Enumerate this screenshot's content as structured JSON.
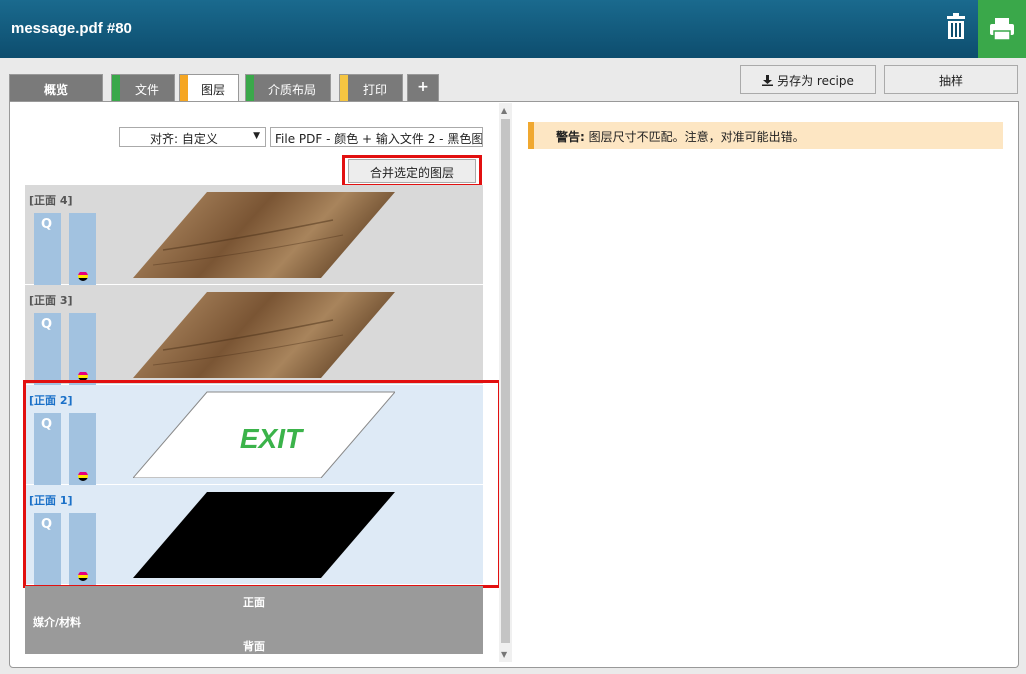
{
  "header": {
    "title": "message.pdf #80"
  },
  "tabs": [
    {
      "label": "概览",
      "active": false,
      "stripe": null
    },
    {
      "label": "文件",
      "active": false,
      "stripe": "#3aa84a"
    },
    {
      "label": "图层",
      "active": true,
      "stripe": "#f5a623"
    },
    {
      "label": "介质布局",
      "active": false,
      "stripe": "#3aa84a"
    },
    {
      "label": "打印",
      "active": false,
      "stripe": "#f5c542"
    },
    {
      "label": "+",
      "active": false,
      "stripe": null
    }
  ],
  "toolbar": {
    "save_recipe_label": "另存为 recipe",
    "sample_label": "抽样"
  },
  "layers_panel": {
    "align_select_value": "对齐: 自定义",
    "file_input_value": "File PDF - 颜色 + 输入文件 2 - 黑色图",
    "merge_button_label": "合并选定的图层",
    "layers": [
      {
        "title": "[正面 4]",
        "selected": false,
        "content": "wood"
      },
      {
        "title": "[正面 3]",
        "selected": false,
        "content": "wood"
      },
      {
        "title": "[正面 2]",
        "selected": true,
        "content": "exit",
        "content_text": "EXIT"
      },
      {
        "title": "[正面 1]",
        "selected": true,
        "content": "black"
      }
    ],
    "q_label": "Q",
    "footer": {
      "front_label": "正面",
      "media_label": "媒介/材料",
      "back_label": "背面"
    }
  },
  "warning": {
    "label_strong": "警告:",
    "message": " 图层尺寸不匹配。注意，对准可能出错。"
  },
  "colors": {
    "header": "#0d4d6e",
    "print_button": "#3aa84a",
    "highlight_box": "#e21010",
    "warning_bg": "#fde6c3",
    "warning_accent": "#f0a830"
  }
}
